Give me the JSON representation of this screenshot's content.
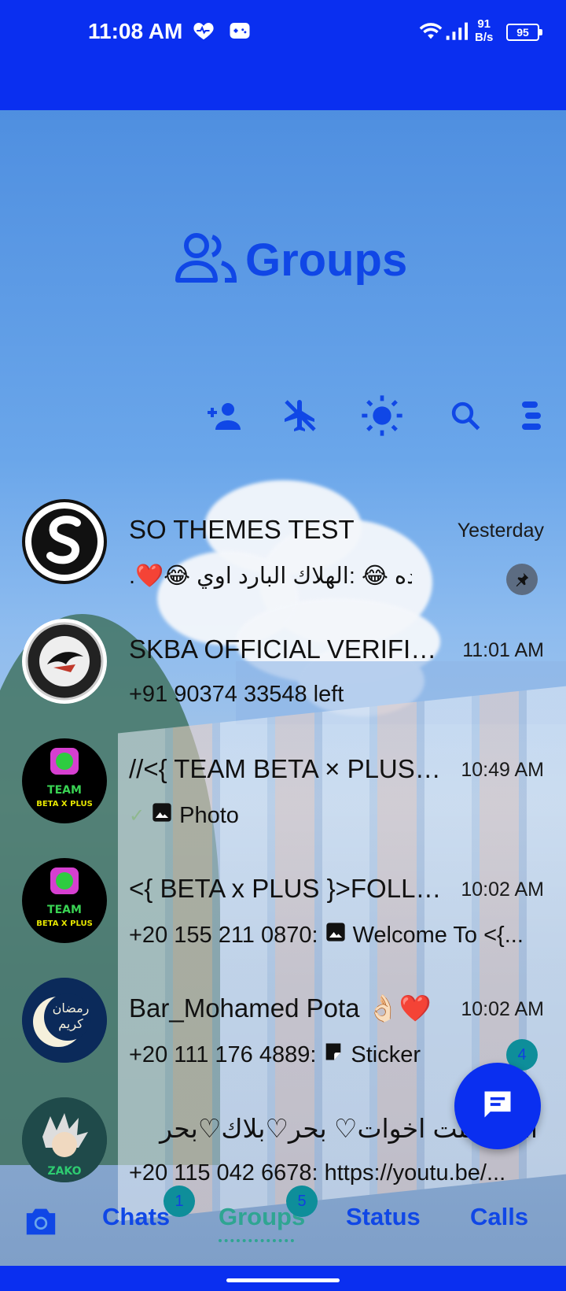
{
  "status_bar": {
    "time": "11:08 AM",
    "net_speed_value": "91",
    "net_speed_unit": "B/s",
    "battery": "95"
  },
  "header": {
    "title": "Groups"
  },
  "toolbar": {
    "icons": [
      "add-contact-icon",
      "airplane-off-icon",
      "brightness-icon",
      "search-icon",
      "menu-icon"
    ]
  },
  "chats": [
    {
      "name": "SO THEMES TEST",
      "time": "Yesterday",
      "preview": "اي ده 😂 :الهلاك البارد اوي 😂❤️.",
      "pinned": true
    },
    {
      "name": "SKBA OFFICIAL VERIFICA...",
      "time": "11:01 AM",
      "preview": "+91 90374 33548 left"
    },
    {
      "name": "//<{ TEAM BETA × PLUS }...",
      "time": "10:49 AM",
      "preview": "Photo",
      "preview_icon": "photo-icon",
      "check": true
    },
    {
      "name": "<{ BETA x PLUS }>FOLLO...",
      "time": "10:02 AM",
      "preview_prefix": "+20 155 211 0870:",
      "preview": "Welcome To <{...",
      "preview_icon": "photo-icon"
    },
    {
      "name": "Bar_Mohamed Pota 👌🏻❤️",
      "time": "10:02 AM",
      "preview_prefix": "+20 111 176 4889:",
      "preview": "Sticker",
      "preview_icon": "sticker-icon",
      "unread": "4"
    },
    {
      "name": "ا...بار تلت اخوات♡ بحر♡بلاك♡بحر",
      "time": "",
      "preview": "+20 115 042 6678: https://youtu.be/..."
    }
  ],
  "bottom_nav": {
    "tabs": [
      {
        "label": "Chats",
        "badge": "1"
      },
      {
        "label": "Groups",
        "badge": "5",
        "active": true
      },
      {
        "label": "Status"
      },
      {
        "label": "Calls"
      }
    ]
  },
  "colors": {
    "primary": "#0a2ff0",
    "accent_text": "#1047e6",
    "badge": "#0e8e9a",
    "active_tab": "#2fa592"
  }
}
